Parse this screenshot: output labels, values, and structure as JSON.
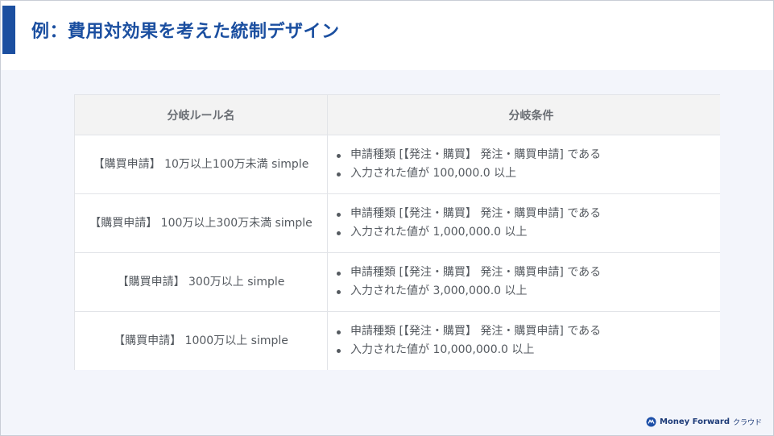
{
  "slide": {
    "title": "例：費用対効果を考えた統制デザイン"
  },
  "table": {
    "headers": [
      "分岐ルール名",
      "分岐条件"
    ],
    "rows": [
      {
        "name": "【購買申請】 10万以上100万未満 simple",
        "conditions": [
          "申請種類 [【発注・購買】 発注・購買申請] である",
          "入力された値が 100,000.0 以上"
        ]
      },
      {
        "name": "【購買申請】 100万以上300万未満 simple",
        "conditions": [
          "申請種類 [【発注・購買】 発注・購買申請] である",
          "入力された値が 1,000,000.0 以上"
        ]
      },
      {
        "name": "【購買申請】 300万以上 simple",
        "conditions": [
          "申請種類 [【発注・購買】 発注・購買申請] である",
          "入力された値が 3,000,000.0 以上"
        ]
      },
      {
        "name": "【購買申請】 1000万以上 simple",
        "conditions": [
          "申請種類 [【発注・購買】 発注・購買申請] である",
          "入力された値が 10,000,000.0 以上"
        ]
      }
    ]
  },
  "footer": {
    "logo_icon": "money-forward-logo-icon",
    "logo_text": "Money Forward",
    "logo_suffix": "クラウド"
  },
  "colors": {
    "accent": "#1b4fa0",
    "background": "#f3f5fb",
    "header_cell": "#f3f3f3",
    "text": "#555a60"
  }
}
